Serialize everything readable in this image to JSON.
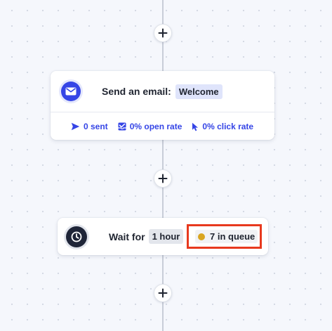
{
  "workflow": {
    "email_step": {
      "icon": "envelope-icon",
      "title": "Send an email:",
      "email_name": "Welcome",
      "stats": {
        "sent": "0 sent",
        "open_rate": "0% open rate",
        "click_rate": "0% click rate"
      }
    },
    "wait_step": {
      "icon": "clock-icon",
      "label": "Wait for",
      "duration": "1 hour",
      "queue": "7 in queue"
    },
    "add_step_buttons": [
      "plus-icon",
      "plus-icon",
      "plus-icon"
    ]
  },
  "colors": {
    "accent": "#3545e6",
    "highlight_border": "#e8391e",
    "queue_dot": "#d9a520",
    "dark_icon": "#1f2538"
  }
}
